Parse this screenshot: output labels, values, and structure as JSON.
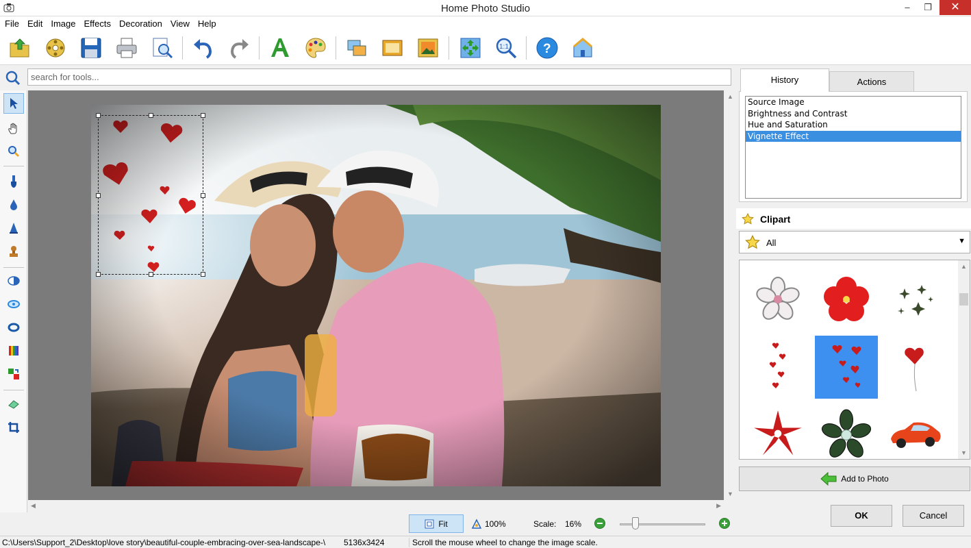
{
  "window": {
    "title": "Home Photo Studio",
    "minimize": "‒",
    "restore": "❐",
    "close": "✕"
  },
  "menu": [
    "File",
    "Edit",
    "Image",
    "Effects",
    "Decoration",
    "View",
    "Help"
  ],
  "toolbar": {
    "icons": [
      "open-icon",
      "camera-roll-icon",
      "save-icon",
      "print-icon",
      "preview-icon",
      "undo-icon",
      "redo-icon",
      "text-icon",
      "palette-icon",
      "collage-icon",
      "frame-icon",
      "photo-frame-icon",
      "fit-window-icon",
      "actual-size-icon",
      "help-icon",
      "home-icon"
    ]
  },
  "search": {
    "placeholder": "search for tools..."
  },
  "left_tools": [
    "pointer-icon",
    "hand-icon",
    "zoom-icon",
    "brush-icon",
    "drop-icon",
    "cone-icon",
    "stamp-icon",
    "contrast-icon",
    "red-eye-icon",
    "ring-icon",
    "color-levels-icon",
    "replace-color-icon",
    "eraser-icon",
    "crop-icon"
  ],
  "history": {
    "tab_history": "History",
    "tab_actions": "Actions",
    "items": [
      "Source Image",
      "Brightness and Contrast",
      "Hue and Saturation",
      "Vignette Effect"
    ],
    "selected_index": 3
  },
  "clipart": {
    "title": "Clipart",
    "category": "All",
    "items": [
      "white-flower",
      "red-hibiscus",
      "green-sparkles",
      "small-hearts-string",
      "scattered-hearts",
      "heart-balloon",
      "red-flower",
      "green-flower",
      "red-car"
    ],
    "selected_index": 4,
    "add_label": "Add to Photo"
  },
  "buttons": {
    "ok": "OK",
    "cancel": "Cancel"
  },
  "zoom": {
    "fit_label": "Fit",
    "actual_label": "100%",
    "scale_label": "Scale:",
    "scale_value": "16%",
    "slider_level": 0.16
  },
  "status": {
    "path": "C:\\Users\\Support_2\\Desktop\\love story\\beautiful-couple-embracing-over-sea-landscape-\\",
    "dimensions": "5136x3424",
    "hint": "Scroll the mouse wheel to change the image scale."
  },
  "colors": {
    "accent": "#3b8fe0",
    "selection": "#3d8ff0",
    "close": "#c7302a",
    "heart": "#d31f1f"
  }
}
